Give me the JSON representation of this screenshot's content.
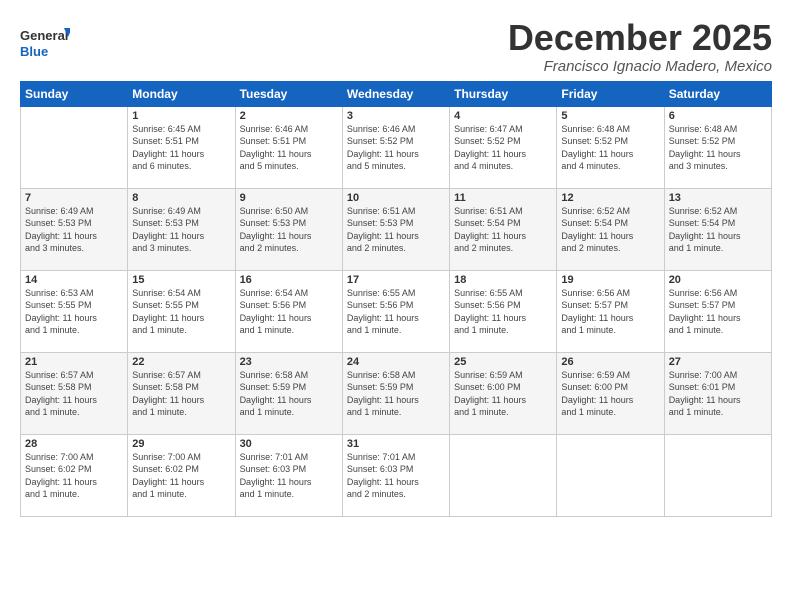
{
  "logo": {
    "line1": "General",
    "line2": "Blue"
  },
  "title": "December 2025",
  "location": "Francisco Ignacio Madero, Mexico",
  "weekdays": [
    "Sunday",
    "Monday",
    "Tuesday",
    "Wednesday",
    "Thursday",
    "Friday",
    "Saturday"
  ],
  "weeks": [
    [
      {
        "day": "",
        "info": ""
      },
      {
        "day": "1",
        "info": "Sunrise: 6:45 AM\nSunset: 5:51 PM\nDaylight: 11 hours\nand 6 minutes."
      },
      {
        "day": "2",
        "info": "Sunrise: 6:46 AM\nSunset: 5:51 PM\nDaylight: 11 hours\nand 5 minutes."
      },
      {
        "day": "3",
        "info": "Sunrise: 6:46 AM\nSunset: 5:52 PM\nDaylight: 11 hours\nand 5 minutes."
      },
      {
        "day": "4",
        "info": "Sunrise: 6:47 AM\nSunset: 5:52 PM\nDaylight: 11 hours\nand 4 minutes."
      },
      {
        "day": "5",
        "info": "Sunrise: 6:48 AM\nSunset: 5:52 PM\nDaylight: 11 hours\nand 4 minutes."
      },
      {
        "day": "6",
        "info": "Sunrise: 6:48 AM\nSunset: 5:52 PM\nDaylight: 11 hours\nand 3 minutes."
      }
    ],
    [
      {
        "day": "7",
        "info": "Sunrise: 6:49 AM\nSunset: 5:53 PM\nDaylight: 11 hours\nand 3 minutes."
      },
      {
        "day": "8",
        "info": "Sunrise: 6:49 AM\nSunset: 5:53 PM\nDaylight: 11 hours\nand 3 minutes."
      },
      {
        "day": "9",
        "info": "Sunrise: 6:50 AM\nSunset: 5:53 PM\nDaylight: 11 hours\nand 2 minutes."
      },
      {
        "day": "10",
        "info": "Sunrise: 6:51 AM\nSunset: 5:53 PM\nDaylight: 11 hours\nand 2 minutes."
      },
      {
        "day": "11",
        "info": "Sunrise: 6:51 AM\nSunset: 5:54 PM\nDaylight: 11 hours\nand 2 minutes."
      },
      {
        "day": "12",
        "info": "Sunrise: 6:52 AM\nSunset: 5:54 PM\nDaylight: 11 hours\nand 2 minutes."
      },
      {
        "day": "13",
        "info": "Sunrise: 6:52 AM\nSunset: 5:54 PM\nDaylight: 11 hours\nand 1 minute."
      }
    ],
    [
      {
        "day": "14",
        "info": "Sunrise: 6:53 AM\nSunset: 5:55 PM\nDaylight: 11 hours\nand 1 minute."
      },
      {
        "day": "15",
        "info": "Sunrise: 6:54 AM\nSunset: 5:55 PM\nDaylight: 11 hours\nand 1 minute."
      },
      {
        "day": "16",
        "info": "Sunrise: 6:54 AM\nSunset: 5:56 PM\nDaylight: 11 hours\nand 1 minute."
      },
      {
        "day": "17",
        "info": "Sunrise: 6:55 AM\nSunset: 5:56 PM\nDaylight: 11 hours\nand 1 minute."
      },
      {
        "day": "18",
        "info": "Sunrise: 6:55 AM\nSunset: 5:56 PM\nDaylight: 11 hours\nand 1 minute."
      },
      {
        "day": "19",
        "info": "Sunrise: 6:56 AM\nSunset: 5:57 PM\nDaylight: 11 hours\nand 1 minute."
      },
      {
        "day": "20",
        "info": "Sunrise: 6:56 AM\nSunset: 5:57 PM\nDaylight: 11 hours\nand 1 minute."
      }
    ],
    [
      {
        "day": "21",
        "info": "Sunrise: 6:57 AM\nSunset: 5:58 PM\nDaylight: 11 hours\nand 1 minute."
      },
      {
        "day": "22",
        "info": "Sunrise: 6:57 AM\nSunset: 5:58 PM\nDaylight: 11 hours\nand 1 minute."
      },
      {
        "day": "23",
        "info": "Sunrise: 6:58 AM\nSunset: 5:59 PM\nDaylight: 11 hours\nand 1 minute."
      },
      {
        "day": "24",
        "info": "Sunrise: 6:58 AM\nSunset: 5:59 PM\nDaylight: 11 hours\nand 1 minute."
      },
      {
        "day": "25",
        "info": "Sunrise: 6:59 AM\nSunset: 6:00 PM\nDaylight: 11 hours\nand 1 minute."
      },
      {
        "day": "26",
        "info": "Sunrise: 6:59 AM\nSunset: 6:00 PM\nDaylight: 11 hours\nand 1 minute."
      },
      {
        "day": "27",
        "info": "Sunrise: 7:00 AM\nSunset: 6:01 PM\nDaylight: 11 hours\nand 1 minute."
      }
    ],
    [
      {
        "day": "28",
        "info": "Sunrise: 7:00 AM\nSunset: 6:02 PM\nDaylight: 11 hours\nand 1 minute."
      },
      {
        "day": "29",
        "info": "Sunrise: 7:00 AM\nSunset: 6:02 PM\nDaylight: 11 hours\nand 1 minute."
      },
      {
        "day": "30",
        "info": "Sunrise: 7:01 AM\nSunset: 6:03 PM\nDaylight: 11 hours\nand 1 minute."
      },
      {
        "day": "31",
        "info": "Sunrise: 7:01 AM\nSunset: 6:03 PM\nDaylight: 11 hours\nand 2 minutes."
      },
      {
        "day": "",
        "info": ""
      },
      {
        "day": "",
        "info": ""
      },
      {
        "day": "",
        "info": ""
      }
    ]
  ]
}
